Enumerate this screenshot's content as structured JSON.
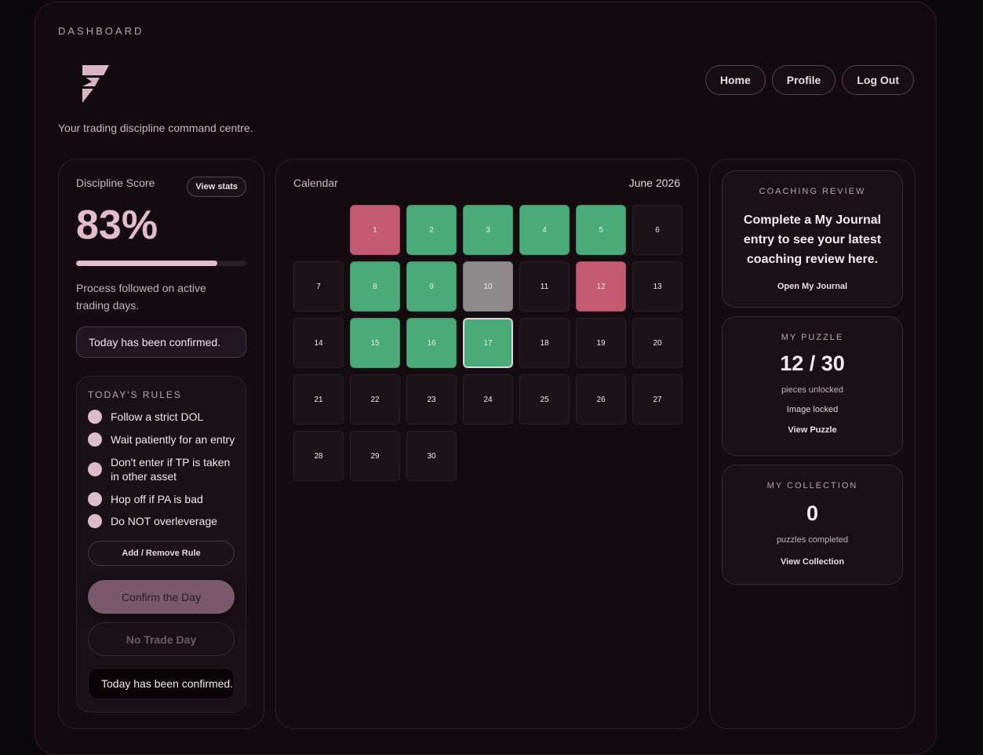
{
  "header": {
    "section_label": "DASHBOARD",
    "tagline": "Your trading discipline command centre.",
    "nav": [
      "Home",
      "Profile",
      "Log Out"
    ]
  },
  "discipline": {
    "label": "Discipline Score",
    "view_stats": "View stats",
    "score": "83%",
    "progress_fraction": 0.83,
    "process_text": "Process followed on active trading days.",
    "status": "Today has been confirmed."
  },
  "rules": {
    "title": "TODAY'S RULES",
    "items": [
      "Follow a strict DOL",
      "Wait patiently for an entry",
      "Don't enter if TP is taken in other asset",
      "Hop off if PA is bad",
      "Do NOT overleverage"
    ],
    "add_remove": "Add / Remove Rule",
    "confirm_day": "Confirm the Day",
    "no_trade_day": "No Trade Day",
    "confirmed_status": "Today has been confirmed."
  },
  "calendar": {
    "title": "Calendar",
    "month": "June 2026",
    "leading_blanks": 1,
    "days": [
      {
        "d": "1",
        "s": "red"
      },
      {
        "d": "2",
        "s": "green"
      },
      {
        "d": "3",
        "s": "green"
      },
      {
        "d": "4",
        "s": "green"
      },
      {
        "d": "5",
        "s": "green"
      },
      {
        "d": "6",
        "s": "none"
      },
      {
        "d": "7",
        "s": "none"
      },
      {
        "d": "8",
        "s": "green"
      },
      {
        "d": "9",
        "s": "green"
      },
      {
        "d": "10",
        "s": "grey"
      },
      {
        "d": "11",
        "s": "none"
      },
      {
        "d": "12",
        "s": "red"
      },
      {
        "d": "13",
        "s": "none"
      },
      {
        "d": "14",
        "s": "none"
      },
      {
        "d": "15",
        "s": "green"
      },
      {
        "d": "16",
        "s": "green"
      },
      {
        "d": "17",
        "s": "green-today"
      },
      {
        "d": "18",
        "s": "none"
      },
      {
        "d": "19",
        "s": "none"
      },
      {
        "d": "20",
        "s": "none"
      },
      {
        "d": "21",
        "s": "none"
      },
      {
        "d": "22",
        "s": "none"
      },
      {
        "d": "23",
        "s": "none"
      },
      {
        "d": "24",
        "s": "none"
      },
      {
        "d": "25",
        "s": "none"
      },
      {
        "d": "26",
        "s": "none"
      },
      {
        "d": "27",
        "s": "none"
      },
      {
        "d": "28",
        "s": "none"
      },
      {
        "d": "29",
        "s": "none"
      },
      {
        "d": "30",
        "s": "none"
      }
    ],
    "colors": {
      "green": "#4aab78",
      "red": "#c45a72",
      "grey": "#8e8a8c"
    }
  },
  "coaching": {
    "title": "COACHING REVIEW",
    "message": "Complete a My Journal entry to see your latest coaching review here.",
    "link": "Open My Journal"
  },
  "puzzle": {
    "title": "MY PUZZLE",
    "count": "12 / 30",
    "caption": "pieces unlocked",
    "status": "Image locked",
    "link": "View Puzzle"
  },
  "collection": {
    "title": "MY COLLECTION",
    "count": "0",
    "caption": "puzzles completed",
    "link": "View Collection"
  },
  "icons": {
    "logo": "brand-logo-icon",
    "rule_dot": "rule-status-dot"
  }
}
